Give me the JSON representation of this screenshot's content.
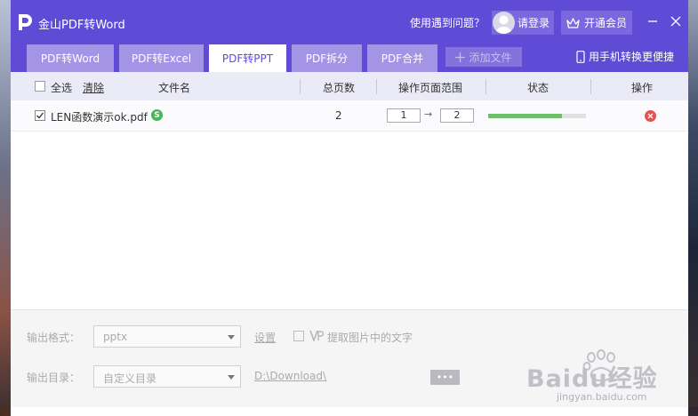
{
  "titlebar": {
    "app_title": "金山PDF转Word",
    "help_text": "使用遇到问题？",
    "login_label": "请登录",
    "vip_label": "开通会员"
  },
  "tabs": [
    {
      "label": "PDF转Word",
      "active": false
    },
    {
      "label": "PDF转Excel",
      "active": false
    },
    {
      "label": "PDF转PPT",
      "active": true
    },
    {
      "label": "PDF拆分",
      "active": false
    },
    {
      "label": "PDF合并",
      "active": false
    }
  ],
  "toolbar": {
    "add_file_label": "添加文件",
    "phone_convert_label": "用手机转换更便捷"
  },
  "table": {
    "select_all_label": "全选",
    "clear_label": "清除",
    "headers": {
      "filename": "文件名",
      "total_pages": "总页数",
      "page_range": "操作页面范围",
      "status": "状态",
      "action": "操作"
    },
    "rows": [
      {
        "checked": true,
        "filename": "LEN函数演示ok.pdf",
        "badge": "S",
        "total_pages": "2",
        "range_from": "1",
        "range_arrow": "→",
        "range_to": "2",
        "progress": 0.75
      }
    ]
  },
  "footer": {
    "format_label": "输出格式：",
    "format_value": "pptx",
    "settings_label": "设置",
    "extract_text_label": "提取图片中的文字",
    "dir_label": "输出目录：",
    "dir_value": "自定义目录",
    "dir_path": "D:\\Download\\",
    "browse_label": "•••"
  },
  "watermark": {
    "brand": "Baidu经验",
    "url": "jingyan.baidu.com"
  },
  "colors": {
    "brand_purple": "#5f4bd6",
    "tab_inactive": "#a494e6",
    "progress_green": "#6cc06a",
    "delete_red": "#e55050"
  }
}
